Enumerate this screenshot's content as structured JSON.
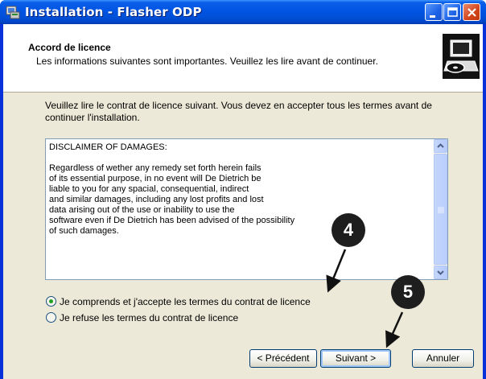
{
  "window": {
    "title": "Installation - Flasher ODP",
    "icon": "installer-icon",
    "controls": [
      "minimize-icon",
      "maximize-icon",
      "close-icon"
    ]
  },
  "header": {
    "title": "Accord de licence",
    "subtitle": "Les informations suivantes sont importantes. Veuillez les lire avant de continuer.",
    "icon": "computer-cd-icon"
  },
  "intro": "Veuillez lire le contrat de licence suivant. Vous devez en accepter tous les termes avant de continuer l'installation.",
  "license": {
    "text": "DISCLAIMER OF DAMAGES:\n\nRegardless of wether any remedy set forth herein fails\nof its essential purpose, in no event will De Dietrich be\nliable to you for any spacial, consequential, indirect\nand similar damages, including any lost profits and lost\ndata arising out of the use or inability to use the\nsoftware even if De Dietrich has been advised of the possibility\nof such damages."
  },
  "options": [
    {
      "label": "Je comprends et j'accepte les termes du contrat de licence",
      "selected": true
    },
    {
      "label": "Je refuse les termes du contrat de licence",
      "selected": false
    }
  ],
  "buttons": {
    "prev": "< Précédent",
    "next": "Suivant >",
    "cancel": "Annuler"
  },
  "callouts": [
    "4",
    "5"
  ],
  "colors": {
    "titlebar": "#0054e3",
    "dialog_bg": "#ece9d8",
    "callout": "#1e1e1e",
    "radio_dot": "#21a121"
  }
}
